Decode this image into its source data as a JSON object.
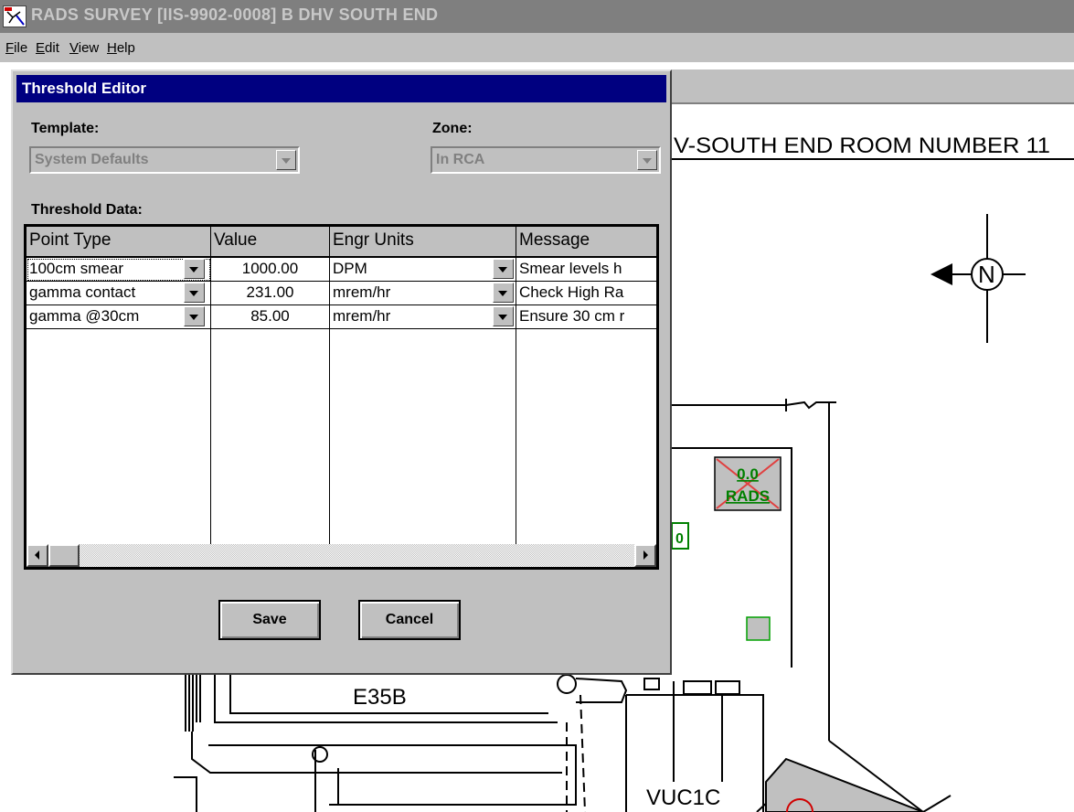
{
  "window": {
    "title": "RADS SURVEY [IIS-9902-0008] B DHV SOUTH END"
  },
  "menu": [
    {
      "label": "File",
      "mnemonic": "F",
      "rest": "ile"
    },
    {
      "label": "Edit",
      "mnemonic": "E",
      "rest": "dit"
    },
    {
      "label": "View",
      "mnemonic": "V",
      "rest": "iew"
    },
    {
      "label": "Help",
      "mnemonic": "H",
      "rest": "elp"
    }
  ],
  "dialog": {
    "title": "Threshold Editor",
    "template_label": "Template:",
    "template_value": "System Defaults",
    "zone_label": "Zone:",
    "zone_value": "In RCA",
    "data_label": "Threshold Data:",
    "columns": [
      "Point Type",
      "Value",
      "Engr Units",
      "Message"
    ],
    "rows": [
      {
        "point_type": "100cm smear",
        "value": "1000.00",
        "units": "DPM",
        "message": "Smear levels h"
      },
      {
        "point_type": "gamma contact",
        "value": "231.00",
        "units": "mrem/hr",
        "message": "Check High Ra"
      },
      {
        "point_type": "gamma @30cm",
        "value": "85.00",
        "units": "mrem/hr",
        "message": "Ensure 30 cm r"
      }
    ],
    "save_label": "Save",
    "cancel_label": "Cancel"
  },
  "floorplan": {
    "header_text": "V-SOUTH END ROOM NUMBER 11",
    "north_label": "N",
    "rads_value": "0.0",
    "rads_label": "RADS",
    "label_e35b": "E35B",
    "label_vuc1c": "VUC1C",
    "partial_marker": "0"
  }
}
